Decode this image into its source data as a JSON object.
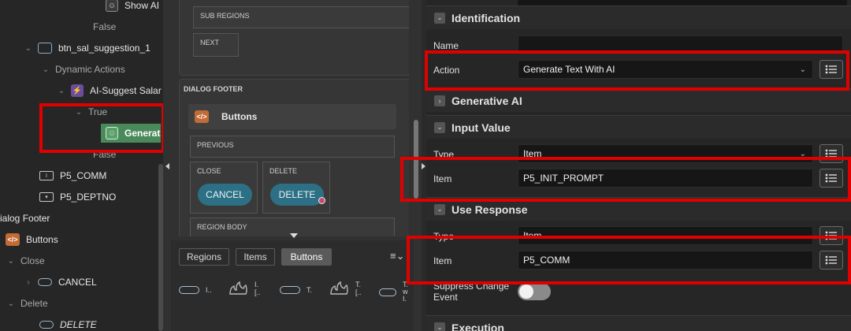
{
  "tree": {
    "show_ai": "Show AI",
    "false_1": "False",
    "btn_sal": "btn_sal_suggestion_1",
    "dynamic_actions": "Dynamic Actions",
    "ai_suggest": "AI-Suggest Salar",
    "true": "True",
    "generate": "Generat",
    "false_2": "False",
    "p5_comm": "P5_COMM",
    "p5_deptno": "P5_DEPTNO",
    "dialog_footer": "ialog Footer",
    "buttons": "Buttons",
    "close": "Close",
    "cancel": "CANCEL",
    "delete": "Delete",
    "delete_btn": "DELETE"
  },
  "layout": {
    "sub_regions": "SUB REGIONS",
    "next": "NEXT",
    "dialog_footer": "DIALOG FOOTER",
    "buttons": "Buttons",
    "previous": "PREVIOUS",
    "close": "CLOSE",
    "delete": "DELETE",
    "cancel_btn": "CANCEL",
    "delete_btn": "DELETE",
    "region_body": "REGION BODY"
  },
  "gallery": {
    "tabs": [
      "Regions",
      "Items",
      "Buttons"
    ],
    "active_tab": "Buttons",
    "items": [
      {
        "icon": "button-pill-icon",
        "label": "I.."
      },
      {
        "icon": "flame-icon",
        "label": "I.\n[.."
      },
      {
        "icon": "button-pill-icon",
        "label": "T."
      },
      {
        "icon": "flame-icon",
        "label": "T.\n[.."
      },
      {
        "icon": "button-pill-icon",
        "label": "T.\nw\nI."
      }
    ]
  },
  "props": {
    "identification": "Identification",
    "name_label": "Name",
    "name_value": "",
    "action_label": "Action",
    "action_value": "Generate Text With AI",
    "generative_ai": "Generative AI",
    "input_value": "Input Value",
    "type_label": "Type",
    "type_value": "Item",
    "item_label": "Item",
    "item_value": "P5_INIT_PROMPT",
    "use_response": "Use Response",
    "type2_label": "Type",
    "type2_value": "Item",
    "item2_label": "Item",
    "item2_value": "P5_COMM",
    "suppress_label": "Suppress Change\nEvent",
    "execution": "Execution"
  },
  "colors": {
    "highlight": "#e00000",
    "selected_node": "#4a8a5a",
    "button_pill": "#2d6f84"
  }
}
